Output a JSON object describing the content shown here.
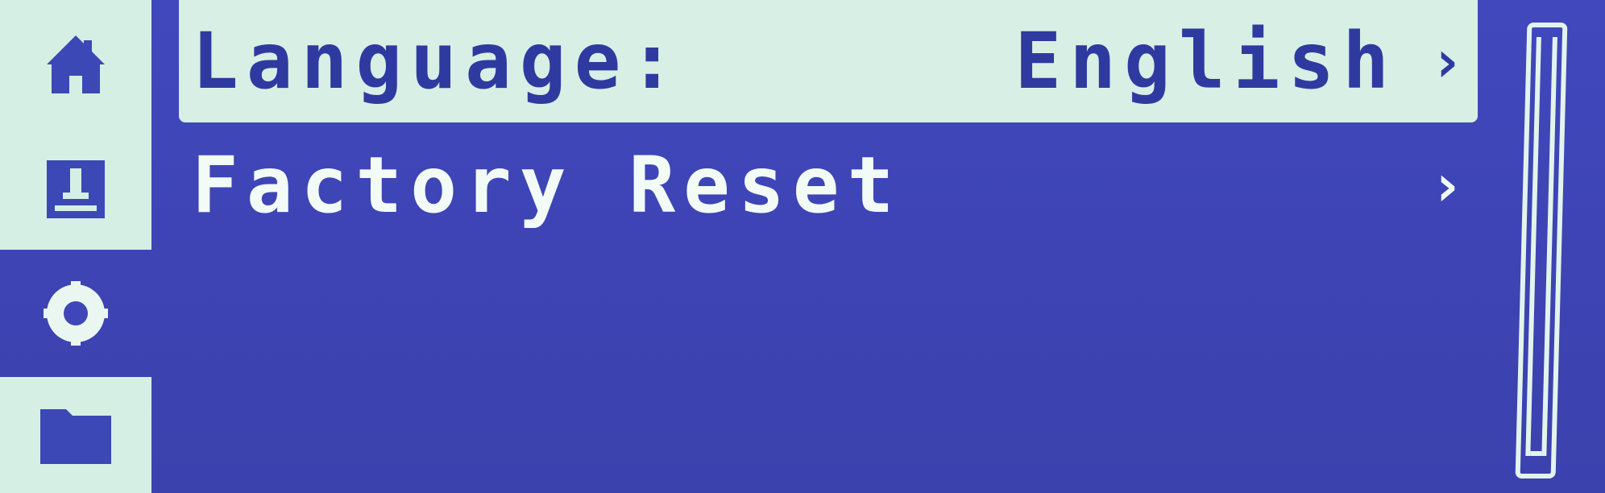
{
  "sidebar": {
    "items": [
      {
        "name": "home",
        "icon": "home-icon",
        "selected": false
      },
      {
        "name": "print",
        "icon": "print-icon",
        "selected": false
      },
      {
        "name": "settings",
        "icon": "gear-icon",
        "selected": true
      },
      {
        "name": "files",
        "icon": "folder-icon",
        "selected": false
      }
    ]
  },
  "menu": {
    "items": [
      {
        "label": "Language:",
        "value": "English",
        "chevron": "›",
        "selected": true
      },
      {
        "label": "Factory Reset",
        "value": "",
        "chevron": "›",
        "selected": false
      }
    ]
  },
  "colors": {
    "background": "#3f46b8",
    "highlight": "#d8efe6",
    "text_light": "#f2fbf6",
    "text_dark": "#2f3aa0"
  }
}
